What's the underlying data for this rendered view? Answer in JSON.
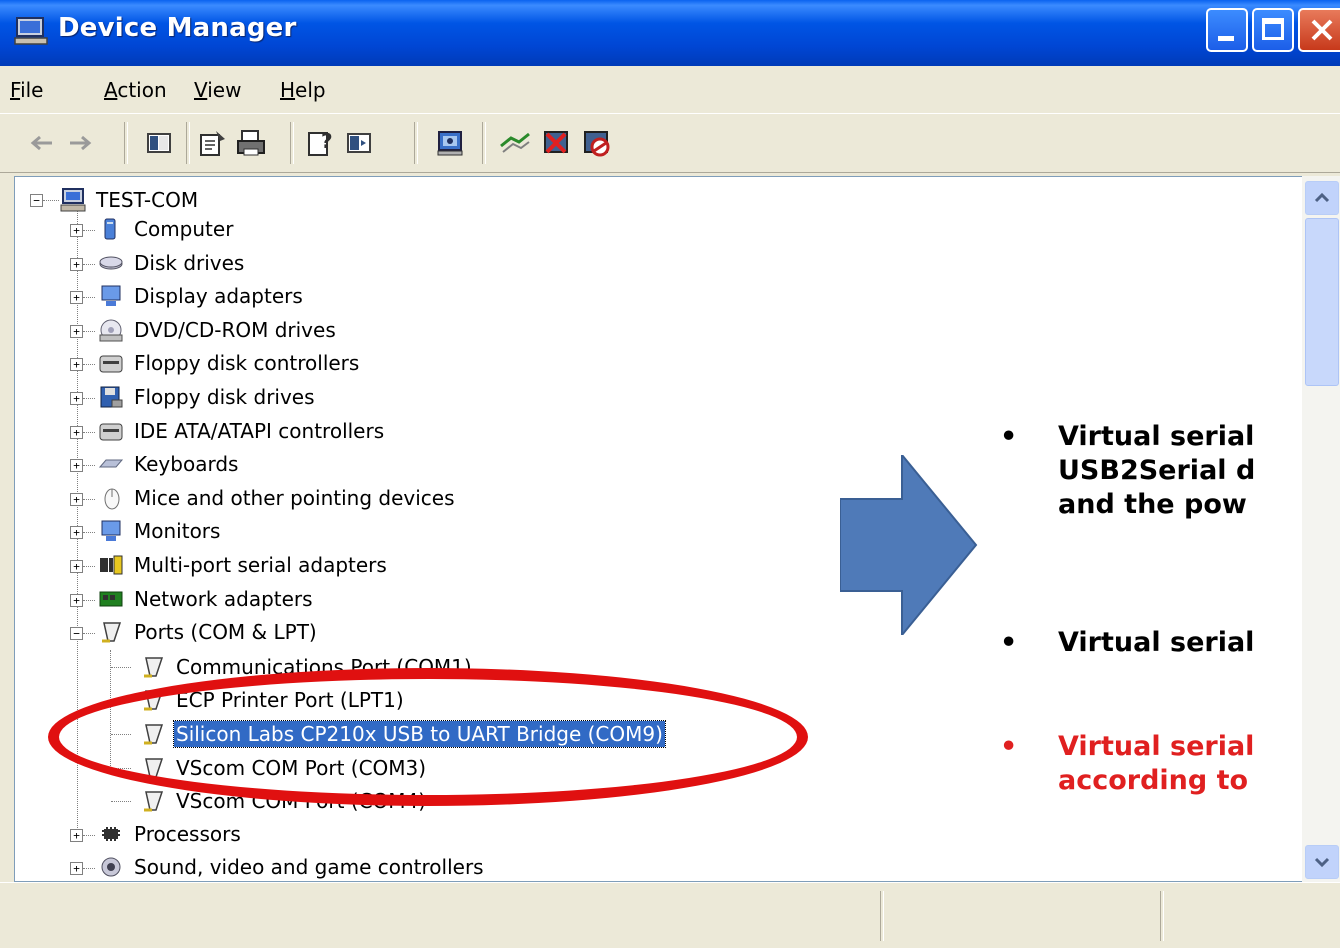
{
  "window": {
    "title": "Device Manager",
    "title_icon": "computer-icon",
    "buttons": [
      "minimize",
      "maximize",
      "close"
    ]
  },
  "menu": {
    "items": [
      {
        "label_prefix": "",
        "mnemonic": "F",
        "rest": "ile"
      },
      {
        "label_prefix": "",
        "mnemonic": "A",
        "rest": "ction"
      },
      {
        "label_prefix": "",
        "mnemonic": "V",
        "rest": "iew"
      },
      {
        "label_prefix": "",
        "mnemonic": "H",
        "rest": "elp"
      }
    ]
  },
  "toolbar": {
    "icons": [
      "back-icon",
      "forward-icon",
      "show-hide-tree-icon",
      "properties-icon",
      "print-icon",
      "help-icon",
      "show-hide-action-pane-icon",
      "scan-hardware-icon",
      "update-driver-icon",
      "uninstall-icon",
      "disable-icon"
    ]
  },
  "tree": {
    "root": "TEST-COM",
    "categories": [
      {
        "label": "Computer",
        "icon": "computer-category-icon",
        "expanded": false
      },
      {
        "label": "Disk drives",
        "icon": "disk-drive-icon",
        "expanded": false
      },
      {
        "label": "Display adapters",
        "icon": "display-adapter-icon",
        "expanded": false
      },
      {
        "label": "DVD/CD-ROM drives",
        "icon": "cdrom-icon",
        "expanded": false
      },
      {
        "label": "Floppy disk controllers",
        "icon": "floppy-controller-icon",
        "expanded": false
      },
      {
        "label": "Floppy disk drives",
        "icon": "floppy-drive-icon",
        "expanded": false
      },
      {
        "label": "IDE ATA/ATAPI controllers",
        "icon": "ide-controller-icon",
        "expanded": false
      },
      {
        "label": "Keyboards",
        "icon": "keyboard-icon",
        "expanded": false
      },
      {
        "label": "Mice and other pointing devices",
        "icon": "mouse-icon",
        "expanded": false
      },
      {
        "label": "Monitors",
        "icon": "monitor-icon",
        "expanded": false
      },
      {
        "label": "Multi-port serial adapters",
        "icon": "serial-adapter-icon",
        "expanded": false
      },
      {
        "label": "Network adapters",
        "icon": "network-adapter-icon",
        "expanded": false
      },
      {
        "label": "Ports (COM & LPT)",
        "icon": "port-icon",
        "expanded": true
      },
      {
        "label": "Processors",
        "icon": "processor-icon",
        "expanded": false
      },
      {
        "label": "Sound, video and game controllers",
        "icon": "sound-icon",
        "expanded": false
      }
    ],
    "ports": [
      {
        "label": "Communications Port (COM1)",
        "selected": false
      },
      {
        "label": "ECP Printer Port (LPT1)",
        "selected": false
      },
      {
        "label": "Silicon Labs CP210x USB to UART Bridge (COM9)",
        "selected": true
      },
      {
        "label": "VScom COM Port (COM3)",
        "selected": false
      },
      {
        "label": "VScom COM Port (COM4)",
        "selected": false
      }
    ]
  },
  "annotation": {
    "bullet_glyph": "•",
    "bullets": [
      {
        "lines": [
          "Virtual serial",
          "USB2Serial d",
          "and the pow"
        ],
        "color": "#000000"
      },
      {
        "lines": [
          "Virtual serial"
        ],
        "color": "#000000"
      },
      {
        "lines": [
          "Virtual serial",
          "according to"
        ],
        "color": "#e02020"
      }
    ],
    "highlight_color": "#e01010",
    "arrow_color": "#4f7ab8"
  }
}
